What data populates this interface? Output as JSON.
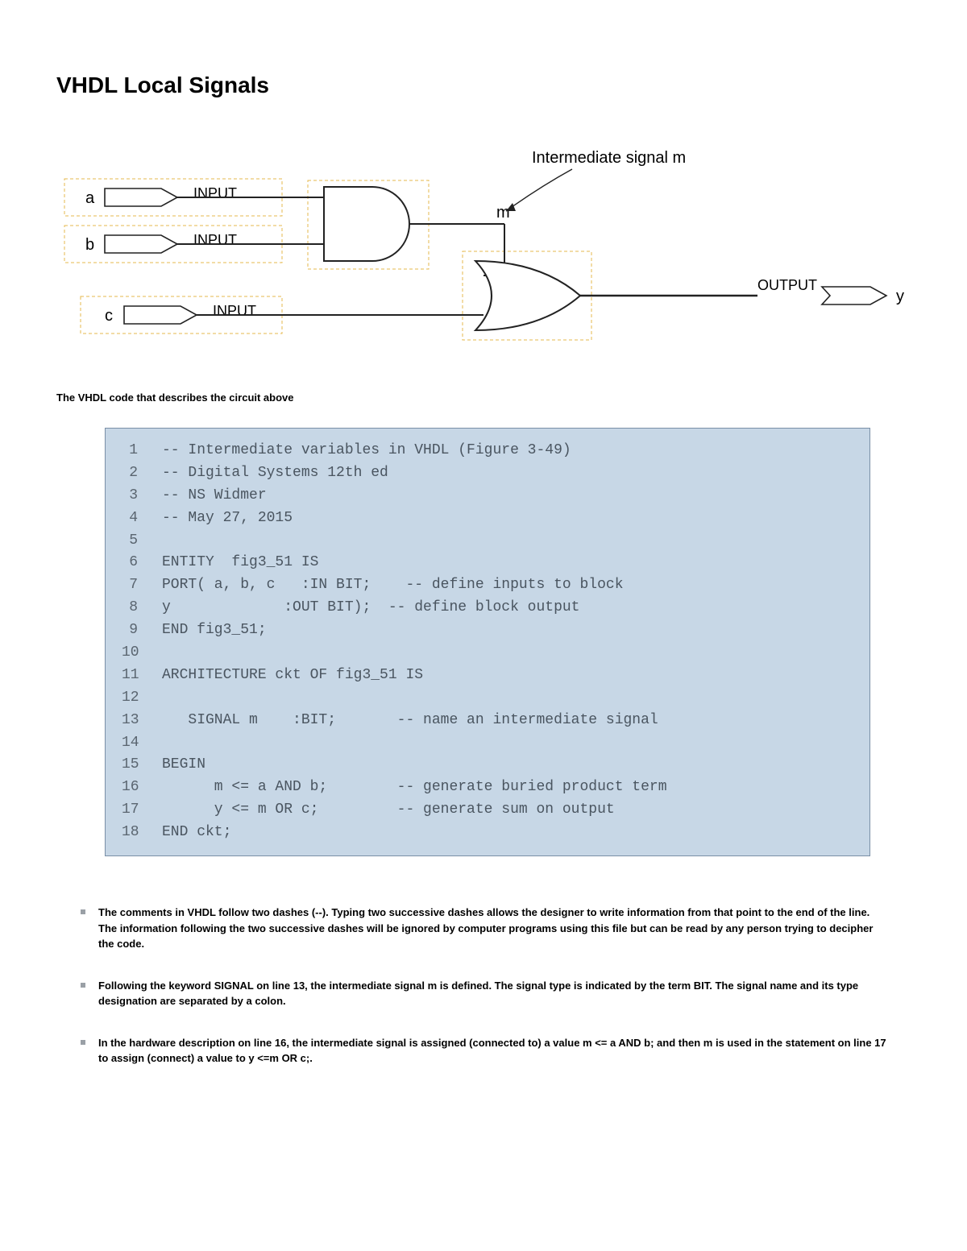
{
  "title": "VHDL Local Signals",
  "diagram": {
    "annotation": "Intermediate signal m",
    "inputs": {
      "a": {
        "name": "a",
        "tag": "INPUT"
      },
      "b": {
        "name": "b",
        "tag": "INPUT"
      },
      "c": {
        "name": "c",
        "tag": "INPUT"
      }
    },
    "signal_m": "m",
    "output": {
      "tag": "OUTPUT",
      "name": "y"
    }
  },
  "caption": "The VHDL code that describes the circuit above",
  "code": {
    "lines": [
      "-- Intermediate variables in VHDL (Figure 3-49)",
      "-- Digital Systems 12th ed",
      "-- NS Widmer",
      "-- May 27, 2015",
      "",
      "ENTITY  fig3_51 IS",
      "PORT( a, b, c   :IN BIT;    -- define inputs to block",
      "y             :OUT BIT);  -- define block output",
      "END fig3_51;",
      "",
      "ARCHITECTURE ckt OF fig3_51 IS",
      "",
      "   SIGNAL m    :BIT;       -- name an intermediate signal",
      "",
      "BEGIN",
      "      m <= a AND b;        -- generate buried product term",
      "      y <= m OR c;         -- generate sum on output",
      "END ckt;"
    ]
  },
  "notes": [
    "The comments in VHDL follow two dashes (--). Typing two successive dashes allows the designer to write information from that point to the end of the line. The information following the two successive dashes will be ignored by computer programs using this file but can be read by any person trying to decipher the code.",
    "Following the keyword SIGNAL on line 13, the intermediate signal m is defined. The signal type is indicated by the term BIT. The signal name and its type designation are separated by a colon.",
    "In the hardware description on line 16, the intermediate signal is assigned (connected to) a value m <= a AND b; and then m is used in the statement on line 17 to assign (connect) a value to y <=m OR c;."
  ]
}
